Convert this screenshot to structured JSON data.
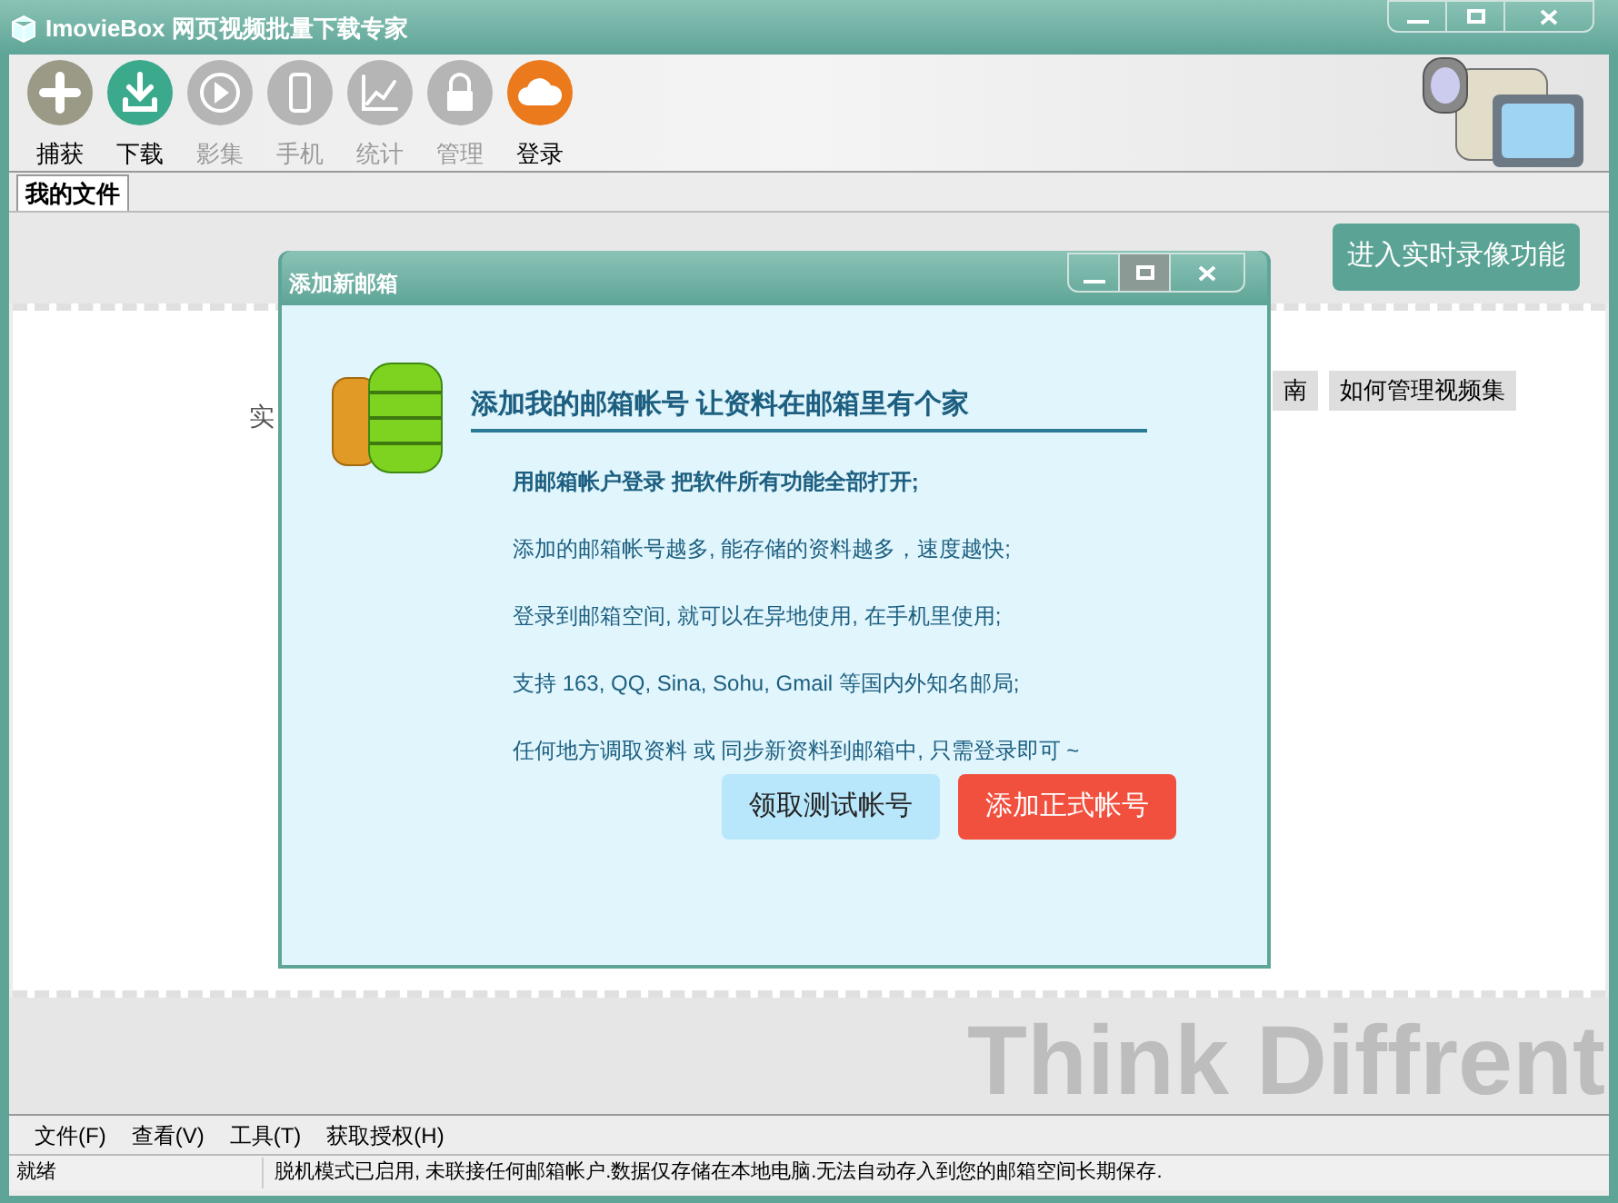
{
  "window": {
    "title": "ImovieBox 网页视频批量下载专家"
  },
  "toolbar": [
    {
      "label": "捕获",
      "kind": "plus",
      "disabled": false
    },
    {
      "label": "下载",
      "kind": "download",
      "disabled": false
    },
    {
      "label": "影集",
      "kind": "play",
      "disabled": true
    },
    {
      "label": "手机",
      "kind": "phone",
      "disabled": true
    },
    {
      "label": "统计",
      "kind": "chart",
      "disabled": true
    },
    {
      "label": "管理",
      "kind": "lock",
      "disabled": true
    },
    {
      "label": "登录",
      "kind": "cloud",
      "disabled": false
    }
  ],
  "tabs": [
    {
      "label": "我的文件",
      "selected": true
    }
  ],
  "record_button": "进入实时录像功能",
  "background": {
    "text": "实",
    "buttons": [
      "南",
      "如何管理视频集"
    ],
    "slogan": "Think Diffrent"
  },
  "dialog": {
    "title": "添加新邮箱",
    "heading": "添加我的邮箱帐号 让资料在邮箱里有个家",
    "lead": "用邮箱帐户登录 把软件所有功能全部打开;",
    "lines": [
      "添加的邮箱帐号越多, 能存储的资料越多，速度越快;",
      "登录到邮箱空间, 就可以在异地使用, 在手机里使用;",
      "支持 163, QQ, Sina, Sohu, Gmail 等国内外知名邮局;",
      "任何地方调取资料 或 同步新资料到邮箱中, 只需登录即可 ~"
    ],
    "buttons": [
      {
        "label": "领取测试帐号",
        "kind": "secondary"
      },
      {
        "label": "添加正式帐号",
        "kind": "primary"
      }
    ]
  },
  "menu": [
    "文件(F)",
    "查看(V)",
    "工具(T)",
    "获取授权(H)"
  ],
  "status_bar": {
    "state": "就绪",
    "message": "脱机模式已启用, 未联接任何邮箱帐户.数据仅存储在本地电脑.无法自动存入到您的邮箱空间长期保存."
  }
}
